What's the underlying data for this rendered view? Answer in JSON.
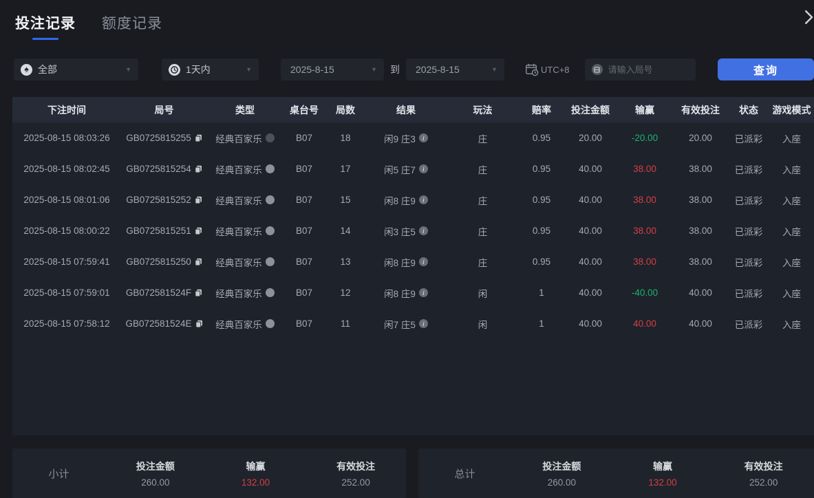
{
  "tabs": [
    {
      "label": "投注记录",
      "active": true
    },
    {
      "label": "额度记录",
      "active": false
    }
  ],
  "filters": {
    "game_type": {
      "value": "全部",
      "icon": "spade-icon"
    },
    "time_range": {
      "value": "1天内",
      "icon": "clock-icon"
    },
    "date_from": "2025-8-15",
    "to_label": "到",
    "date_to": "2025-8-15",
    "timezone_label": "UTC+8",
    "timezone_icon": "calendar-clock-icon",
    "round_input_placeholder": "请输入局号",
    "query_button": "查询"
  },
  "table": {
    "headers": [
      "下注时间",
      "局号",
      "类型",
      "桌台号",
      "局数",
      "结果",
      "玩法",
      "赔率",
      "投注金额",
      "输赢",
      "有效投注",
      "状态",
      "游戏模式"
    ],
    "rows": [
      {
        "time": "2025-08-15 08:03:26",
        "round_id": "GB0725815255",
        "game_type": "经典百家乐",
        "type_icon_shade": "dark",
        "table_no": "B07",
        "round_no": "18",
        "result": "闲9 庄3",
        "play": "庄",
        "odds": "0.95",
        "bet_amount": "20.00",
        "win_loss": "-20.00",
        "valid_bet": "20.00",
        "status": "已派彩",
        "mode": "入座"
      },
      {
        "time": "2025-08-15 08:02:45",
        "round_id": "GB0725815254",
        "game_type": "经典百家乐",
        "type_icon_shade": "light",
        "table_no": "B07",
        "round_no": "17",
        "result": "闲5 庄7",
        "play": "庄",
        "odds": "0.95",
        "bet_amount": "40.00",
        "win_loss": "38.00",
        "valid_bet": "38.00",
        "status": "已派彩",
        "mode": "入座"
      },
      {
        "time": "2025-08-15 08:01:06",
        "round_id": "GB0725815252",
        "game_type": "经典百家乐",
        "type_icon_shade": "light",
        "table_no": "B07",
        "round_no": "15",
        "result": "闲8 庄9",
        "play": "庄",
        "odds": "0.95",
        "bet_amount": "40.00",
        "win_loss": "38.00",
        "valid_bet": "38.00",
        "status": "已派彩",
        "mode": "入座"
      },
      {
        "time": "2025-08-15 08:00:22",
        "round_id": "GB0725815251",
        "game_type": "经典百家乐",
        "type_icon_shade": "light",
        "table_no": "B07",
        "round_no": "14",
        "result": "闲3 庄5",
        "play": "庄",
        "odds": "0.95",
        "bet_amount": "40.00",
        "win_loss": "38.00",
        "valid_bet": "38.00",
        "status": "已派彩",
        "mode": "入座"
      },
      {
        "time": "2025-08-15 07:59:41",
        "round_id": "GB0725815250",
        "game_type": "经典百家乐",
        "type_icon_shade": "light",
        "table_no": "B07",
        "round_no": "13",
        "result": "闲8 庄9",
        "play": "庄",
        "odds": "0.95",
        "bet_amount": "40.00",
        "win_loss": "38.00",
        "valid_bet": "38.00",
        "status": "已派彩",
        "mode": "入座"
      },
      {
        "time": "2025-08-15 07:59:01",
        "round_id": "GB072581524F",
        "game_type": "经典百家乐",
        "type_icon_shade": "light",
        "table_no": "B07",
        "round_no": "12",
        "result": "闲8 庄9",
        "play": "闲",
        "odds": "1",
        "bet_amount": "40.00",
        "win_loss": "-40.00",
        "valid_bet": "40.00",
        "status": "已派彩",
        "mode": "入座"
      },
      {
        "time": "2025-08-15 07:58:12",
        "round_id": "GB072581524E",
        "game_type": "经典百家乐",
        "type_icon_shade": "light",
        "table_no": "B07",
        "round_no": "11",
        "result": "闲7 庄5",
        "play": "闲",
        "odds": "1",
        "bet_amount": "40.00",
        "win_loss": "40.00",
        "valid_bet": "40.00",
        "status": "已派彩",
        "mode": "入座"
      }
    ]
  },
  "summary": {
    "columns": [
      "投注金额",
      "输赢",
      "有效投注"
    ],
    "subtotal": {
      "label": "小计",
      "bet_amount": "260.00",
      "win_loss": "132.00",
      "valid_bet": "252.00"
    },
    "total": {
      "label": "总计",
      "bet_amount": "260.00",
      "win_loss": "132.00",
      "valid_bet": "252.00"
    }
  },
  "colors": {
    "accent_blue": "#4170e2",
    "tab_underline": "#2e68f0",
    "win_red": "#d24043",
    "loss_green": "#1cb36d"
  }
}
